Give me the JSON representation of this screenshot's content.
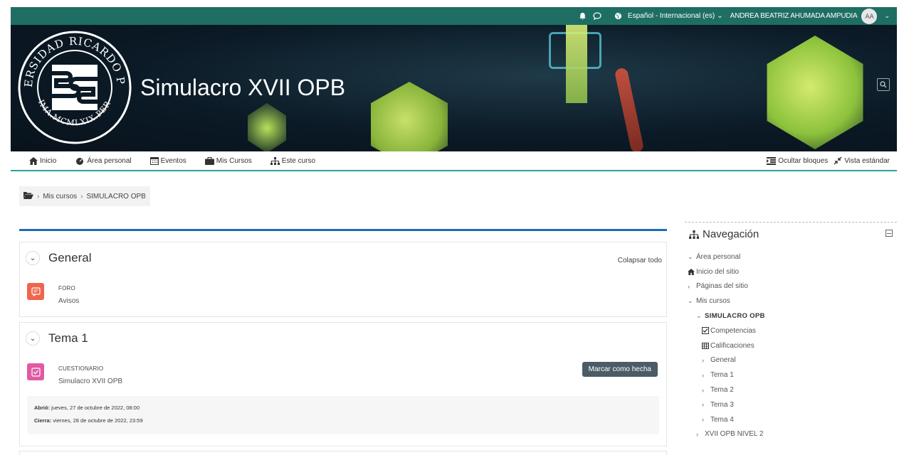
{
  "topbar": {
    "language": "Español - Internacional (es)",
    "user_name": "ANDREA BEATRIZ AHUMADA AMPUDIA",
    "avatar_initials": "AA"
  },
  "banner": {
    "logo_text_top": "UNIVERSIDAD RICARDO PALMA",
    "logo_text_bottom": "LIMA.MCMLXIX.PERU",
    "course_title": "Simulacro XVII OPB"
  },
  "navbar": {
    "items": [
      "Inicio",
      "Área personal",
      "Eventos",
      "Mis Cursos",
      "Este curso"
    ],
    "hide_blocks": "Ocultar bloques",
    "standard_view": "Vista estándar"
  },
  "breadcrumb": {
    "items": [
      "Mis cursos",
      "SIMULACRO OPB"
    ]
  },
  "sections": {
    "collapse_all": "Colapsar todo",
    "general": {
      "title": "General",
      "activity": {
        "type": "FORO",
        "name": "Avisos"
      }
    },
    "tema1": {
      "title": "Tema 1",
      "activity": {
        "type": "CUESTIONARIO",
        "name": "Simulacro XVII OPB"
      },
      "mark_done": "Marcar como hecha",
      "opened_label": "Abrió:",
      "opened_value": " jueves, 27 de octubre de 2022, 08:00",
      "closes_label": "Cierra:",
      "closes_value": " viernes, 28 de octubre de 2022, 23:59"
    }
  },
  "navigation_block": {
    "title": "Navegación",
    "items": [
      {
        "label": "Área personal"
      },
      {
        "label": "Inicio del sitio"
      },
      {
        "label": "Páginas del sitio"
      },
      {
        "label": "Mis cursos"
      },
      {
        "label": "SIMULACRO OPB"
      },
      {
        "label": "Competencias"
      },
      {
        "label": "Calificaciones"
      },
      {
        "label": "General"
      },
      {
        "label": "Tema 1"
      },
      {
        "label": "Tema 2"
      },
      {
        "label": "Tema 3"
      },
      {
        "label": "Tema 4"
      },
      {
        "label": "XVII OPB NIVEL 2"
      }
    ]
  },
  "colors": {
    "topbar": "#1e6e64",
    "accent_line": "#2ea39a",
    "blue_line": "#1e6bb8",
    "foro_icon": "#f0654d",
    "quiz_icon": "#e15aa4",
    "mark_button": "#4b5c66"
  }
}
